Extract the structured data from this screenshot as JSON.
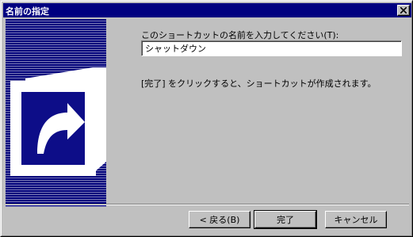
{
  "window": {
    "title": "名前の指定",
    "close_icon": "close-icon"
  },
  "art": {
    "icon": "shortcut-arrow-icon"
  },
  "form": {
    "prompt_label": "このショートカットの名前を入力してください(T):",
    "name_value": "シャットダウン",
    "info_text": "[完了] をクリックすると、ショートカットが作成されます。"
  },
  "buttons": {
    "back": "< 戻る(B)",
    "finish": "完了",
    "cancel": "キャンセル"
  },
  "colors": {
    "titlebar": "#000080",
    "face": "#c0c0c0",
    "art_background": "#000080"
  }
}
